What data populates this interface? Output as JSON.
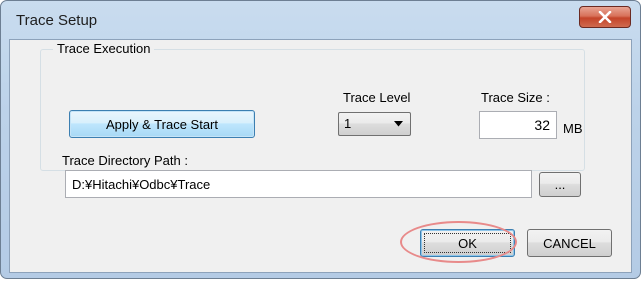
{
  "window": {
    "title": "Trace Setup",
    "close_label": "X"
  },
  "group": {
    "legend": "Trace Execution",
    "apply_button_label": "Apply & Trace Start",
    "trace_level_label": "Trace Level",
    "trace_level_value": "1",
    "trace_size_label": "Trace Size :",
    "trace_size_value": "32",
    "trace_size_unit": "MB",
    "directory_label": "Trace Directory Path :",
    "directory_value": "D:¥Hitachi¥Odbc¥Trace",
    "browse_label": "..."
  },
  "footer": {
    "ok_label": "OK",
    "cancel_label": "CANCEL"
  },
  "colors": {
    "highlight_ring": "#e88a8a",
    "close_button": "#c4442a"
  }
}
